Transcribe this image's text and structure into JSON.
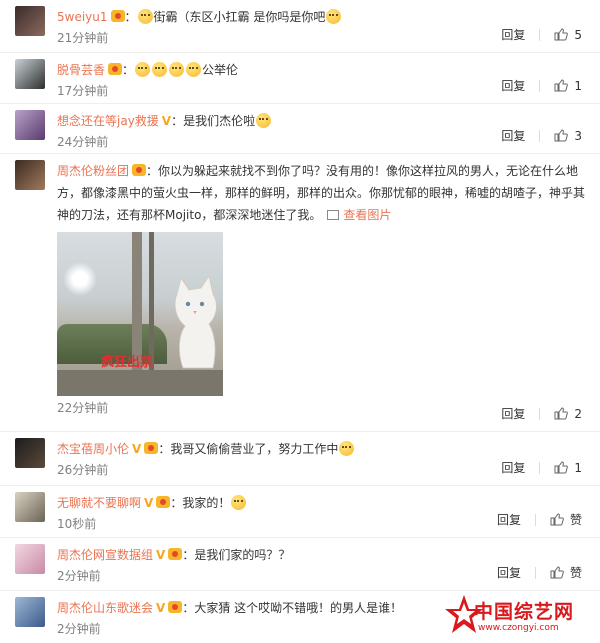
{
  "colors": {
    "accent": "#eb7350",
    "text": "#333333",
    "muted": "#808080",
    "logo": "#d9191c"
  },
  "comments": [
    {
      "user": "5weiyu1",
      "badges": [
        "level-badge"
      ],
      "emoji_before": true,
      "text": "街霸（东区小扛霸 是你吗是你吧",
      "emoji_after": true,
      "time": "21分钟前",
      "reply": "回复",
      "likes": "5"
    },
    {
      "user": "脱骨芸香",
      "badges": [
        "level-badge"
      ],
      "emoji_row": 4,
      "text": "公举伦",
      "time": "17分钟前",
      "reply": "回复",
      "likes": "1"
    },
    {
      "user": "想念还在等jay救援",
      "badges": [
        "vip-badge"
      ],
      "text": "：是我们杰伦啦",
      "emoji_after": true,
      "time": "24分钟前",
      "reply": "回复",
      "likes": "3"
    },
    {
      "user": "周杰伦粉丝团",
      "badges": [
        "level-badge"
      ],
      "text": "：你以为躲起来就找不到你了吗？没有用的！像你这样拉风的男人，无论在什么地方，都像漆黑中的萤火虫一样，那样的鲜明，那样的出众。你那忧郁的眼神，稀嘘的胡喳子，神乎其神的刀法，还有那杯Mojito，都深深地迷住了我。",
      "view_pic": "查看图片",
      "photo_watermark": "疯狂出票",
      "time": "22分钟前",
      "reply": "回复",
      "likes": "2"
    },
    {
      "user": "杰宝蓓周小伦",
      "badges": [
        "vip-badge",
        "level-badge"
      ],
      "text": "：我哥又偷偷营业了，努力工作中",
      "emoji_after": true,
      "time": "26分钟前",
      "reply": "回复",
      "likes": "1"
    },
    {
      "user": "无聊就不要聊啊",
      "badges": [
        "vip-badge",
        "level-badge"
      ],
      "text": "：我家的！",
      "emoji_after": true,
      "time": "10秒前",
      "reply": "回复",
      "likes": "赞"
    },
    {
      "user": "周杰伦网宣数据组",
      "badges": [
        "vip-badge",
        "level-badge"
      ],
      "text": "：是我们家的吗？？",
      "time": "2分钟前",
      "reply": "回复",
      "likes": "赞"
    },
    {
      "user": "周杰伦山东歌迷会",
      "badges": [
        "vip-badge",
        "level-badge"
      ],
      "text": "：大家猜 这个哎呦不错哦！的男人是谁！",
      "time": "2分钟前",
      "reply": "回复",
      "likes": ""
    }
  ],
  "vip_mark": "V",
  "logo": {
    "title": "中国综艺网",
    "url": "www.czongyi.com"
  }
}
